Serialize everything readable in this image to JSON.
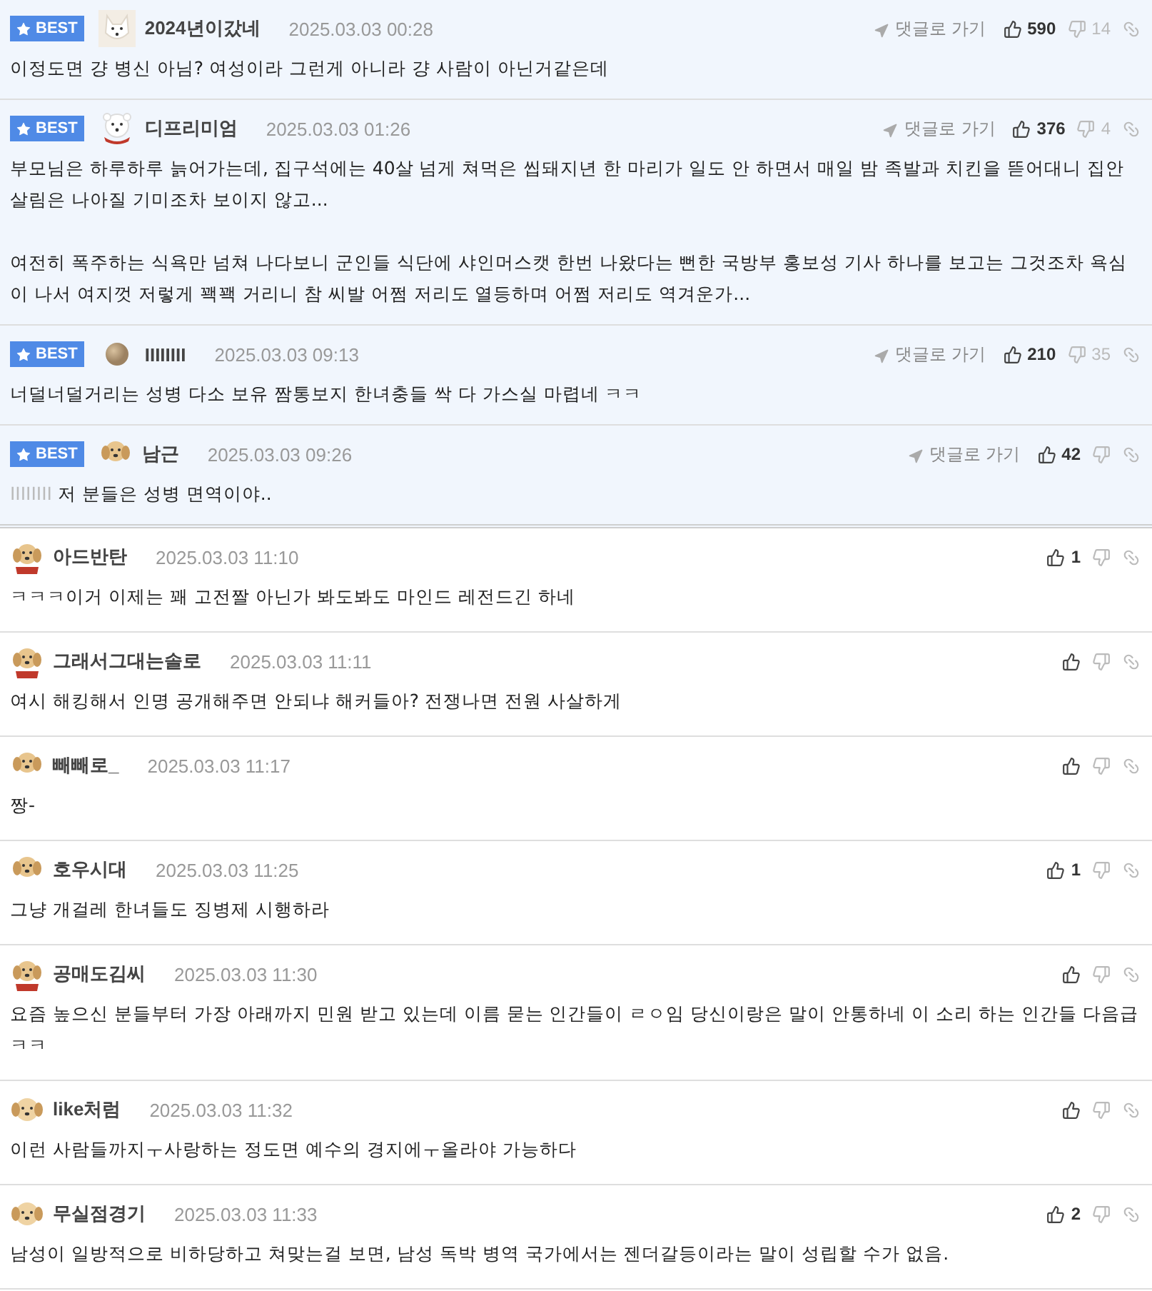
{
  "comments": [
    {
      "best": true,
      "badge": "BEST",
      "nickname": "2024년이갔네",
      "date": "2025.03.03 00:28",
      "goto": "댓글로 가기",
      "up": "590",
      "down": "14",
      "paragraphs": [
        "이정도면 걍 병신 아님? 여성이라 그런게 아니라 걍 사람이 아닌거같은데"
      ]
    },
    {
      "best": true,
      "badge": "BEST",
      "nickname": "디프리미엄",
      "date": "2025.03.03 01:26",
      "goto": "댓글로 가기",
      "up": "376",
      "down": "4",
      "paragraphs": [
        "부모님은 하루하루 늙어가는데, 집구석에는 40살 넘게 쳐먹은 씹돼지년 한 마리가 일도 안 하면서 매일 밤 족발과 치킨을 뜯어대니 집안 살림은 나아질 기미조차 보이지 않고...",
        "여전히 폭주하는 식욕만 넘쳐 나다보니 군인들 식단에 샤인머스캣 한번 나왔다는 뻔한 국방부 홍보성 기사 하나를 보고는 그것조차 욕심이 나서 여지껏 저렇게 꽥꽥 거리니 참 씨발 어쩜 저리도 열등하며 어쩜 저리도 역겨운가..."
      ]
    },
    {
      "best": true,
      "badge": "BEST",
      "nickname": "IIIIIIII",
      "date": "2025.03.03 09:13",
      "goto": "댓글로 가기",
      "up": "210",
      "down": "35",
      "paragraphs": [
        "너덜너덜거리는 성병 다소 보유 짬통보지 한녀충들 싹 다 가스실 마렵네 ㅋㅋ"
      ]
    },
    {
      "best": true,
      "badge": "BEST",
      "nickname": "남근",
      "date": "2025.03.03 09:26",
      "goto": "댓글로 가기",
      "up": "42",
      "mention": "IIIIIIII",
      "paragraphs": [
        "저 분들은 성병 면역이야.."
      ]
    },
    {
      "best": false,
      "nickname": "아드반탄",
      "date": "2025.03.03 11:10",
      "up": "1",
      "paragraphs": [
        "ㅋㅋㅋ이거 이제는 꽤 고전짤 아닌가 봐도봐도 마인드 레전드긴 하네"
      ]
    },
    {
      "best": false,
      "nickname": "그래서그대는솔로",
      "date": "2025.03.03 11:11",
      "paragraphs": [
        "여시 해킹해서 인명 공개해주면 안되냐 해커들아? 전쟁나면 전원 사살하게"
      ]
    },
    {
      "best": false,
      "nickname": "빼빼로_",
      "date": "2025.03.03 11:17",
      "paragraphs": [
        "짱-"
      ]
    },
    {
      "best": false,
      "nickname": "호우시대",
      "date": "2025.03.03 11:25",
      "up": "1",
      "paragraphs": [
        "그냥 개걸레 한녀들도 징병제 시행하라"
      ]
    },
    {
      "best": false,
      "nickname": "공매도김씨",
      "date": "2025.03.03 11:30",
      "paragraphs": [
        "요즘 높으신 분들부터 가장 아래까지 민원 받고 있는데 이름 묻는 인간들이 ㄹㅇ임 당신이랑은 말이 안통하네 이 소리 하는 인간들 다음급 ㅋㅋ"
      ]
    },
    {
      "best": false,
      "nickname": "like처럼",
      "date": "2025.03.03 11:32",
      "paragraphs": [
        "이런 사람들까지ㅜ사랑하는 정도면 예수의 경지에ㅜ올라야 가능하다"
      ]
    },
    {
      "best": false,
      "nickname": "무실점경기",
      "date": "2025.03.03 11:33",
      "up": "2",
      "paragraphs": [
        "남성이 일방적으로 비하당하고 쳐맞는걸 보면, 남성 독박 병역 국가에서는 젠더갈등이라는 말이 성립할 수가 없음."
      ]
    }
  ]
}
